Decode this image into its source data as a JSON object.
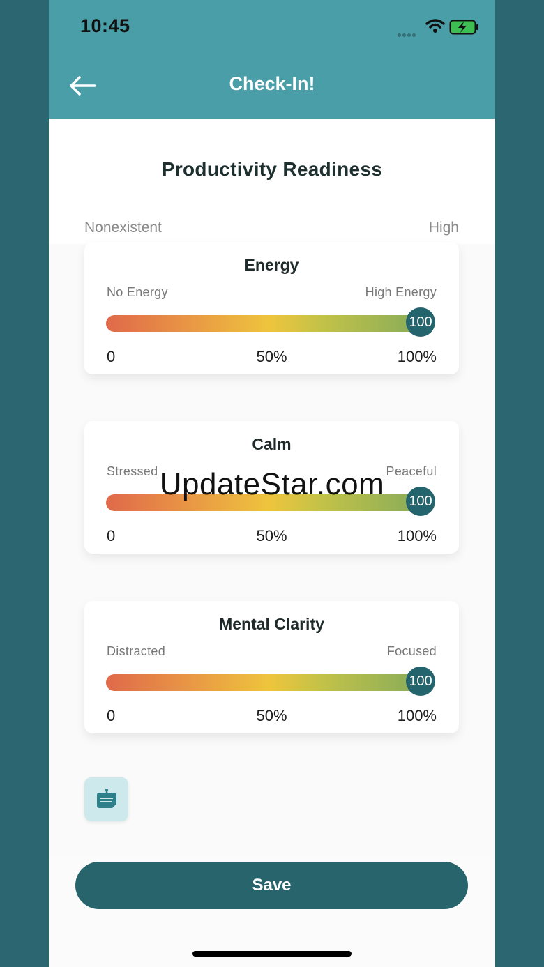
{
  "status_bar": {
    "time": "10:45"
  },
  "header": {
    "title": "Check-In!"
  },
  "section": {
    "title": "Productivity Readiness",
    "scale_low": "Nonexistent",
    "scale_high": "High"
  },
  "sliders": [
    {
      "title": "Energy",
      "low_label": "No Energy",
      "high_label": "High Energy",
      "value": "100",
      "value_percent": 100,
      "ticks": [
        "0",
        "50%",
        "100%"
      ]
    },
    {
      "title": "Calm",
      "low_label": "Stressed",
      "high_label": "Peaceful",
      "value": "100",
      "value_percent": 100,
      "ticks": [
        "0",
        "50%",
        "100%"
      ]
    },
    {
      "title": "Mental Clarity",
      "low_label": "Distracted",
      "high_label": "Focused",
      "value": "100",
      "value_percent": 100,
      "ticks": [
        "0",
        "50%",
        "100%"
      ]
    }
  ],
  "note_button": {
    "icon": "note-icon"
  },
  "save_button": {
    "label": "Save"
  },
  "watermark": "UpdateStar.com",
  "colors": {
    "header": "#4a9ea8",
    "primary": "#28646c",
    "gradient_start": "#e0694a",
    "gradient_mid": "#eec53d",
    "gradient_end": "#80a95b"
  }
}
